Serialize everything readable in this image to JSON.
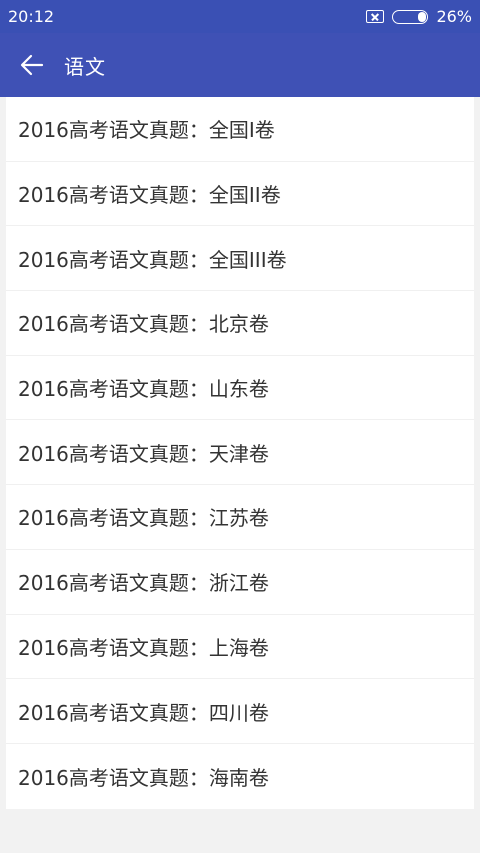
{
  "status_bar": {
    "time": "20:12",
    "battery_percent": "26%",
    "battery_level": 0.26,
    "sim_icon": "no-sim-icon",
    "battery_icon": "battery-icon"
  },
  "app_bar": {
    "title": "语文",
    "back_icon": "back-arrow-icon",
    "background": "#3f51b5"
  },
  "items": [
    {
      "label": "2016高考语文真题：全国I卷"
    },
    {
      "label": "2016高考语文真题：全国II卷"
    },
    {
      "label": "2016高考语文真题：全国III卷"
    },
    {
      "label": "2016高考语文真题：北京卷"
    },
    {
      "label": "2016高考语文真题：山东卷"
    },
    {
      "label": "2016高考语文真题：天津卷"
    },
    {
      "label": "2016高考语文真题：江苏卷"
    },
    {
      "label": "2016高考语文真题：浙江卷"
    },
    {
      "label": "2016高考语文真题：上海卷"
    },
    {
      "label": "2016高考语文真题：四川卷"
    },
    {
      "label": "2016高考语文真题：海南卷"
    }
  ]
}
